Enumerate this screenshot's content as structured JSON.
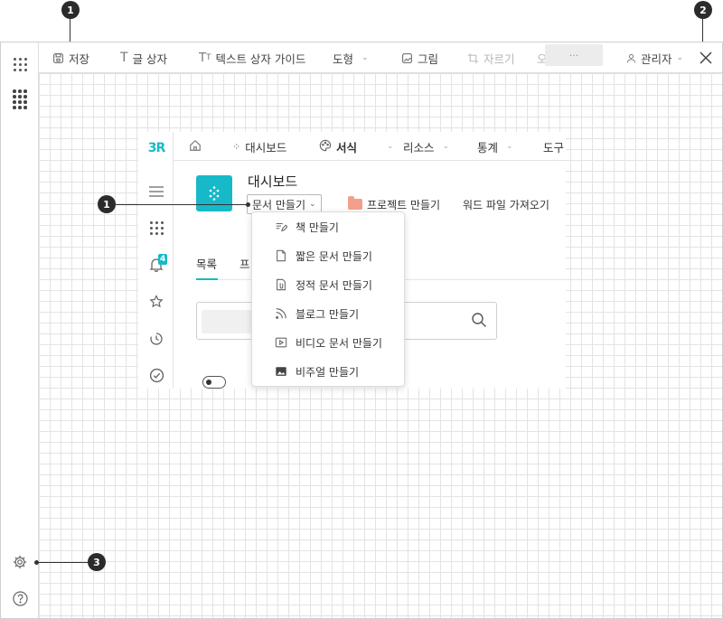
{
  "toolbar": {
    "save": "저장",
    "text_box": "글 상자",
    "text_box_guide": "텍스트 상자 가이드",
    "shape": "도형",
    "image": "그림",
    "crop": "자르기",
    "hidden_partial": "오",
    "more": "···",
    "user": "관리자",
    "close_icon": "close-icon"
  },
  "app": {
    "logo_text": "3R",
    "nav": {
      "dashboard": "대시보드",
      "format": "서식",
      "resources": "리소스",
      "stats": "통계",
      "tools": "도구"
    },
    "page_title": "대시보드",
    "create_doc": "문서 만들기",
    "create_project": "프로젝트 만들기",
    "import_word": "워드 파일 가져오기",
    "tabs": [
      "목록",
      "프"
    ],
    "notification_count": "4"
  },
  "menu": {
    "items": [
      {
        "label": "책 만들기",
        "icon": "book-edit-icon"
      },
      {
        "label": "짧은 문서 만들기",
        "icon": "document-icon"
      },
      {
        "label": "정적 문서 만들기",
        "icon": "attachment-icon"
      },
      {
        "label": "블로그 만들기",
        "icon": "rss-icon"
      },
      {
        "label": "비디오 문서 만들기",
        "icon": "video-icon"
      },
      {
        "label": "비주얼 만들기",
        "icon": "image-icon"
      }
    ]
  },
  "callouts": [
    "1",
    "2",
    "3",
    "1"
  ],
  "colors": {
    "accent": "#17b9c8",
    "folder": "#f2a08d",
    "badge": "#2b2b2b",
    "grid": "#e3e3e3"
  }
}
